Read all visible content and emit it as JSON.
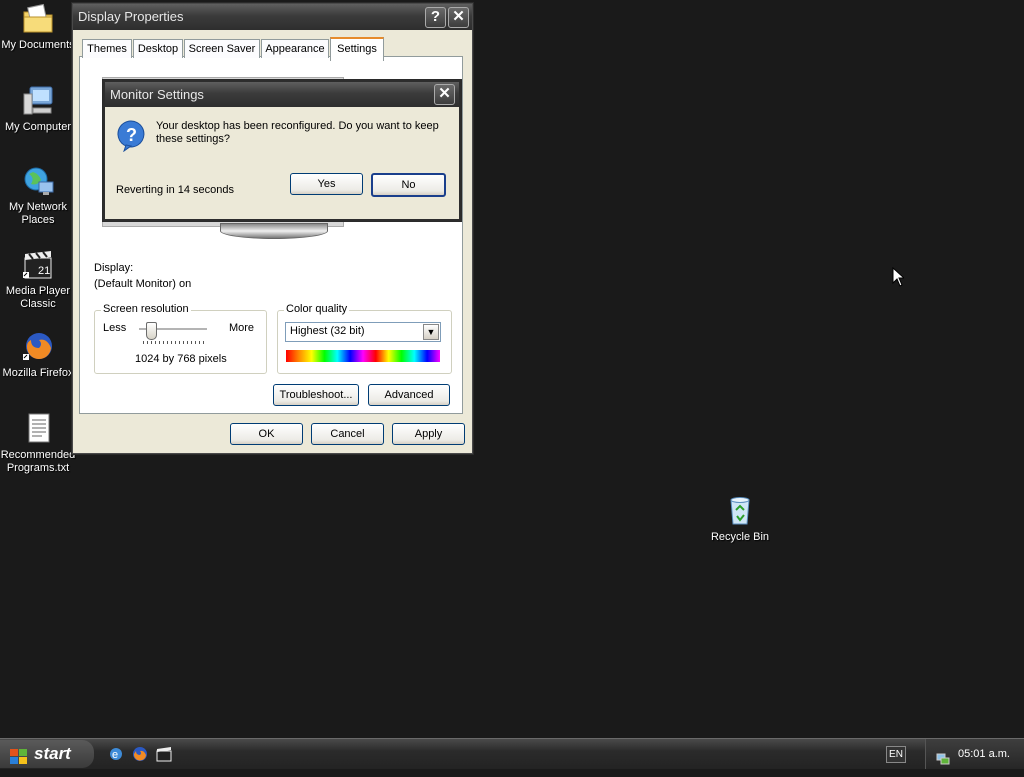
{
  "desktop": {
    "icons": [
      {
        "label": "My Documents"
      },
      {
        "label": "My Computer"
      },
      {
        "label": "My Network Places"
      },
      {
        "label": "Media Player Classic"
      },
      {
        "label": "Mozilla Firefox"
      },
      {
        "label": "Recommended Programs.txt"
      },
      {
        "label": "Recycle Bin"
      }
    ]
  },
  "display_properties": {
    "title": "Display Properties",
    "help_glyph": "?",
    "close_glyph": "✕",
    "tabs": [
      "Themes",
      "Desktop",
      "Screen Saver",
      "Appearance",
      "Settings"
    ],
    "active_tab": "Settings",
    "display_label": "Display:",
    "display_value": "(Default Monitor) on",
    "resolution": {
      "group_title": "Screen resolution",
      "less_label": "Less",
      "more_label": "More",
      "value_text": "1024 by 768 pixels"
    },
    "color_quality": {
      "group_title": "Color quality",
      "selected": "Highest (32 bit)"
    },
    "troubleshoot_label": "Troubleshoot...",
    "advanced_label": "Advanced",
    "ok_label": "OK",
    "cancel_label": "Cancel",
    "apply_label": "Apply"
  },
  "monitor_dialog": {
    "title": "Monitor Settings",
    "message": "Your desktop has been reconfigured.  Do you want to keep these settings?",
    "countdown": "Reverting in 14 seconds",
    "yes_label": "Yes",
    "no_label": "No",
    "question_glyph": "?"
  },
  "taskbar": {
    "start_label": "start",
    "language": "EN",
    "clock": "05:01 a.m."
  },
  "colors": {
    "desktop_bg": "#1a1a1a",
    "titlebar": "#3b3b3b",
    "dialog_bg": "#ece9d8",
    "button_border": "#003c74"
  }
}
